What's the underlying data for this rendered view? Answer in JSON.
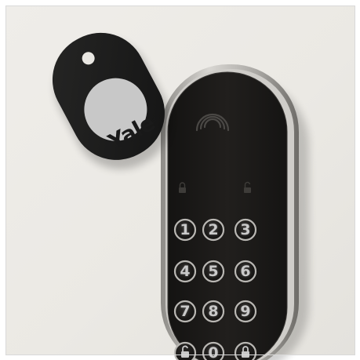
{
  "scene": {
    "wall_color": "#ece9e4",
    "lock_body_color": "#1b1a18",
    "lock_trim_color": "#b8b6b2",
    "fob_color": "#1c1c1c",
    "logo_disc_color": "#c8c8c8"
  },
  "key_fob": {
    "brand": "Yale",
    "trademark": "®",
    "icon": "key-fob-tag"
  },
  "keypad": {
    "contactless_icon": "nfc-wave-icon",
    "indicator_icons": [
      "lock-indicator-icon",
      "unlock-indicator-icon"
    ],
    "keys": [
      {
        "label": "1"
      },
      {
        "label": "2"
      },
      {
        "label": "3"
      },
      {
        "label": "4"
      },
      {
        "label": "5"
      },
      {
        "label": "6"
      },
      {
        "label": "7"
      },
      {
        "label": "8"
      },
      {
        "label": "9"
      },
      {
        "icon": "unlock-icon"
      },
      {
        "label": "0"
      },
      {
        "icon": "lock-icon"
      }
    ]
  }
}
